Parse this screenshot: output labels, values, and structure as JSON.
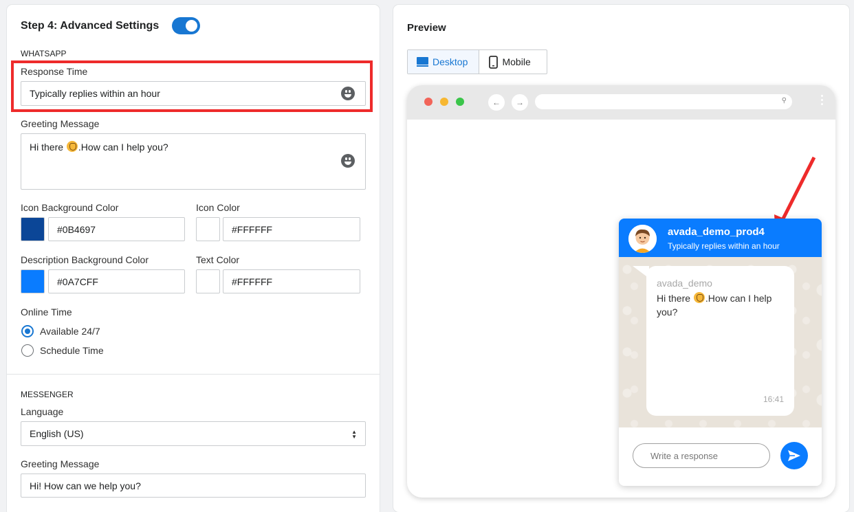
{
  "left": {
    "step_title": "Step 4: Advanced Settings",
    "whatsapp": {
      "section_label": "WHATSAPP",
      "response_time_label": "Response Time",
      "response_time_value": "Typically replies within an hour",
      "greeting_label": "Greeting Message",
      "greeting_before": "Hi there ",
      "greeting_after": ".How can I help you?",
      "icon_bg_label": "Icon Background Color",
      "icon_bg_value": "#0B4697",
      "icon_color_label": "Icon Color",
      "icon_color_value": "#FFFFFF",
      "desc_bg_label": "Description Background Color",
      "desc_bg_value": "#0A7CFF",
      "text_color_label": "Text Color",
      "text_color_value": "#FFFFFF",
      "online_time_label": "Online Time",
      "option_available": "Available 24/7",
      "option_schedule": "Schedule Time"
    },
    "messenger": {
      "section_label": "MESSENGER",
      "language_label": "Language",
      "language_value": "English (US)",
      "greeting_label": "Greeting Message",
      "greeting_value": "Hi! How can we help you?"
    }
  },
  "preview": {
    "title": "Preview",
    "tab_desktop": "Desktop",
    "tab_mobile": "Mobile",
    "widget": {
      "name": "avada_demo_prod4",
      "reply_time": "Typically replies within an hour",
      "sender": "avada_demo",
      "msg_before": "Hi there ",
      "msg_after": ".How can I help you?",
      "time": "16:41",
      "input_placeholder": "Write a response"
    }
  },
  "colors": {
    "accent": "#1877d2",
    "widget_header": "#0A7CFF",
    "icon_bg": "#0B4697",
    "highlight": "#ee2b2b"
  }
}
